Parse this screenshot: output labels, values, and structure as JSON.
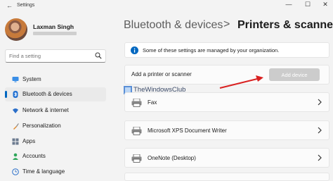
{
  "window": {
    "title": "Settings",
    "back_glyph": "←",
    "minimize_glyph": "—",
    "maximize_glyph": "☐",
    "close_glyph": "✕"
  },
  "user": {
    "name": "Laxman Singh"
  },
  "search": {
    "placeholder": "Find a setting"
  },
  "sidebar": {
    "items": [
      {
        "label": "System",
        "icon": "monitor-icon"
      },
      {
        "label": "Bluetooth & devices",
        "icon": "bluetooth-icon",
        "active": true
      },
      {
        "label": "Network & internet",
        "icon": "wifi-icon"
      },
      {
        "label": "Personalization",
        "icon": "brush-icon"
      },
      {
        "label": "Apps",
        "icon": "apps-icon"
      },
      {
        "label": "Accounts",
        "icon": "person-icon"
      },
      {
        "label": "Time & language",
        "icon": "globe-clock-icon"
      }
    ]
  },
  "breadcrumb": {
    "parent": "Bluetooth & devices",
    "separator": ">",
    "current": "Printers & scanners"
  },
  "notice": {
    "text": "Some of these settings are managed by your organization."
  },
  "add_printer": {
    "label": "Add a printer or scanner",
    "button_label": "Add device"
  },
  "watermark": {
    "text": "TheWindowsClub"
  },
  "printers": [
    {
      "name": "Fax"
    },
    {
      "name": "Microsoft XPS Document Writer"
    },
    {
      "name": "OneNote (Desktop)"
    },
    {
      "name": ""
    }
  ],
  "colors": {
    "accent": "#0067c0",
    "annotation_arrow": "#d92121",
    "disabled_button": "#cccccc"
  }
}
